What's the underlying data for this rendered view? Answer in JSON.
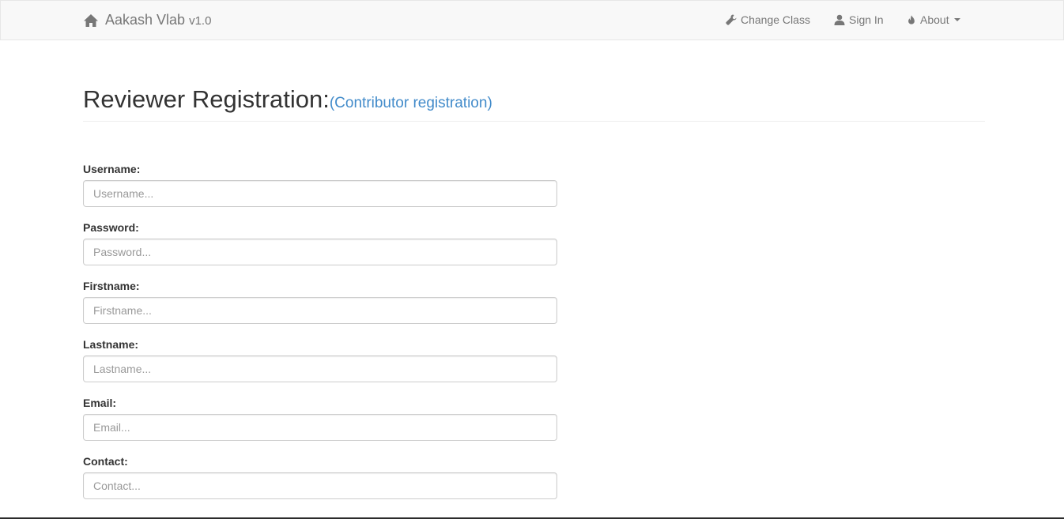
{
  "navbar": {
    "brand_name": "Aakash Vlab",
    "brand_version": "v1.0",
    "brand_icon": "home-icon",
    "items": [
      {
        "label": "Change Class",
        "icon": "wrench-icon"
      },
      {
        "label": "Sign In",
        "icon": "user-icon"
      },
      {
        "label": "About",
        "icon": "fire-icon",
        "dropdown": true
      }
    ]
  },
  "header": {
    "title": "Reviewer Registration:",
    "link": "(Contributor registration)"
  },
  "form": {
    "fields": [
      {
        "label": "Username:",
        "placeholder": "Username...",
        "value": ""
      },
      {
        "label": "Password:",
        "placeholder": "Password...",
        "value": ""
      },
      {
        "label": "Firstname:",
        "placeholder": "Firstname...",
        "value": ""
      },
      {
        "label": "Lastname:",
        "placeholder": "Lastname...",
        "value": ""
      },
      {
        "label": "Email:",
        "placeholder": "Email...",
        "value": ""
      },
      {
        "label": "Contact:",
        "placeholder": "Contact...",
        "value": ""
      }
    ]
  },
  "colors": {
    "navbar_bg": "#f8f8f8",
    "nav_text": "#777777",
    "link": "#428bca",
    "text": "#333333"
  }
}
